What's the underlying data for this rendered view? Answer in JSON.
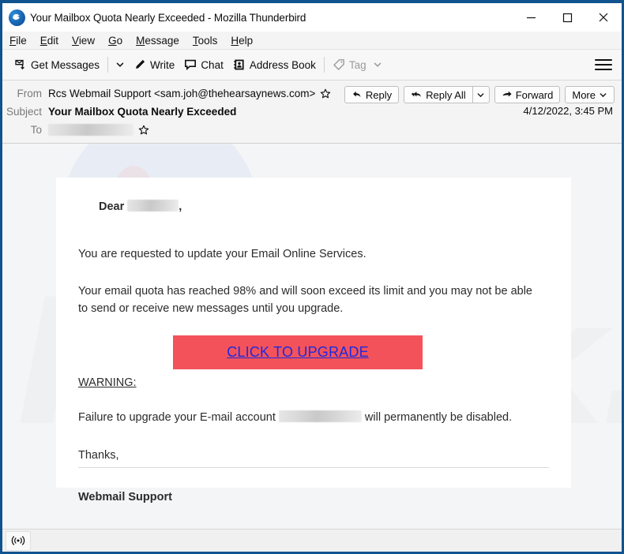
{
  "window": {
    "title": "Your Mailbox Quota Nearly Exceeded - Mozilla Thunderbird",
    "logo_icon": "thunderbird-logo-icon",
    "controls": {
      "minimize": "minimize-icon",
      "maximize": "maximize-icon",
      "close": "close-icon"
    },
    "border_color": "#10538f"
  },
  "menu": {
    "items": [
      {
        "label": "File",
        "accesskey": "F"
      },
      {
        "label": "Edit",
        "accesskey": "E"
      },
      {
        "label": "View",
        "accesskey": "V"
      },
      {
        "label": "Go",
        "accesskey": "G"
      },
      {
        "label": "Message",
        "accesskey": "M"
      },
      {
        "label": "Tools",
        "accesskey": "T"
      },
      {
        "label": "Help",
        "accesskey": "H"
      }
    ]
  },
  "toolbar": {
    "get_messages_label": "Get Messages",
    "write_label": "Write",
    "chat_label": "Chat",
    "address_book_label": "Address Book",
    "tag_label": "Tag",
    "tag_disabled": true,
    "menu_icon": "hamburger-menu-icon"
  },
  "message_header": {
    "from_label": "From",
    "from_value": "Rcs Webmail Support <sam.joh@thehearsaynews.com>",
    "subject_label": "Subject",
    "subject_value": "Your Mailbox Quota Nearly Exceeded",
    "to_label": "To",
    "to_value_redacted": true,
    "date": "4/12/2022, 3:45 PM",
    "actions": {
      "reply": "Reply",
      "reply_all": "Reply All",
      "forward": "Forward",
      "more": "More"
    }
  },
  "email": {
    "greeting_prefix": "Dear",
    "greeting_suffix": ",",
    "greeting_redacted": true,
    "paragraph1": "You are requested to update your Email Online Services.",
    "paragraph2": "Your email quota has reached 98% and will soon exceed its limit and you may not be able to send or receive new messages until you upgrade.",
    "cta_label": "CLICK TO UPGRADE",
    "cta_bg_color": "#f4525b",
    "cta_text_color": "#1a2ae0",
    "warning_label": "WARNING:",
    "warning_color": "#e8302c",
    "failure_prefix": "Failure to upgrade your E-mail account",
    "failure_suffix": "will permanently be disabled.",
    "failure_redacted": true,
    "thanks": "Thanks,",
    "signature": "Webmail Support"
  },
  "status_bar": {
    "connection_icon": "broadcast-signal-icon"
  }
}
